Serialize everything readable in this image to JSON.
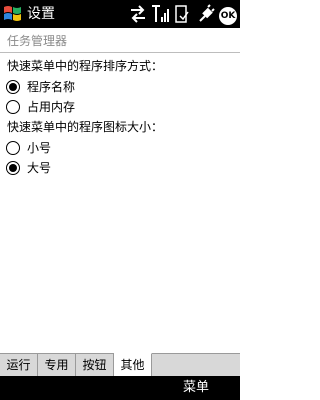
{
  "title_bar": {
    "title": "设置",
    "ok_label": "OK"
  },
  "page": {
    "subtitle": "任务管理器"
  },
  "sort_section": {
    "label": "快速菜单中的程序排序方式：",
    "options": [
      {
        "label": "程序名称",
        "checked": true
      },
      {
        "label": "占用内存",
        "checked": false
      }
    ]
  },
  "icon_size_section": {
    "label": "快速菜单中的程序图标大小：",
    "options": [
      {
        "label": "小号",
        "checked": false
      },
      {
        "label": "大号",
        "checked": true
      }
    ]
  },
  "tabs": [
    {
      "label": "运行",
      "active": false
    },
    {
      "label": "专用",
      "active": false
    },
    {
      "label": "按钮",
      "active": false
    },
    {
      "label": "其他",
      "active": true
    }
  ],
  "softkeys": {
    "left": "",
    "right": "菜单"
  },
  "icons": {
    "logo": "windows-flag-icon",
    "sync": "sync-arrows-icon",
    "signal": "signal-strength-icon",
    "battery": "battery-icon",
    "connectivity": "plug-icon"
  }
}
